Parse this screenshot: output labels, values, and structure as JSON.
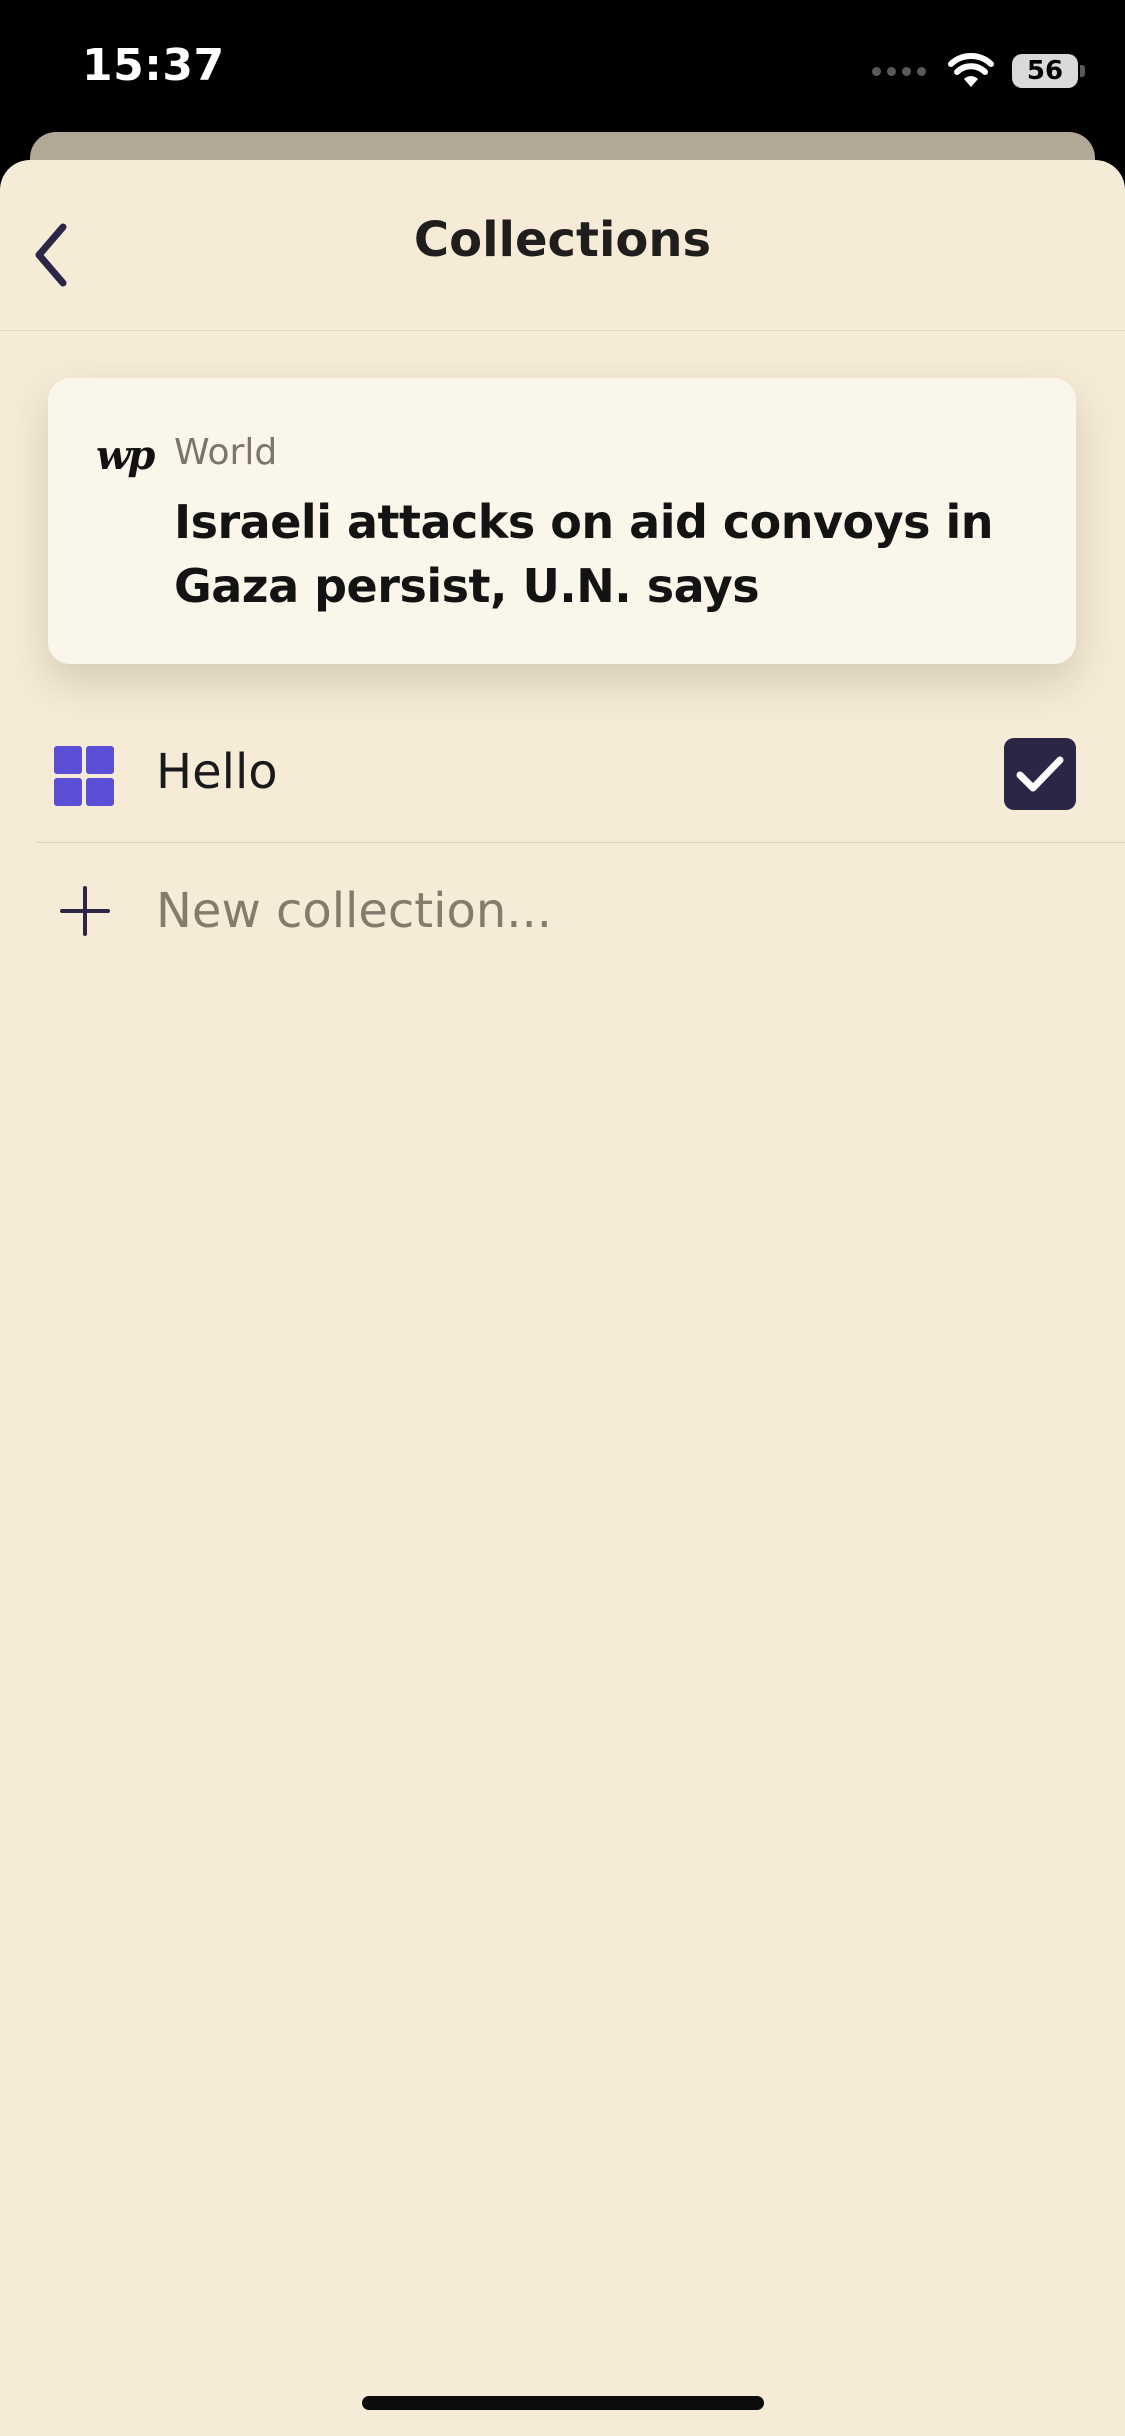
{
  "status_bar": {
    "time": "15:37",
    "battery": "56"
  },
  "nav": {
    "title": "Collections",
    "back_icon": "chevron-left-icon"
  },
  "article": {
    "logo_text": "wp",
    "section": "World",
    "title": "Israeli attacks on aid convoys in Gaza persist, U.N. says"
  },
  "collections": {
    "items": [
      {
        "name": "Hello",
        "icon": "grid-icon",
        "checked": true
      }
    ],
    "new_placeholder": "New collection..."
  },
  "colors": {
    "background": "#f5ebd7",
    "card": "#fbf6ea",
    "accent_icon": "#5b4fd6",
    "checkbox": "#2b2645",
    "nav_icon": "#2b2645"
  }
}
